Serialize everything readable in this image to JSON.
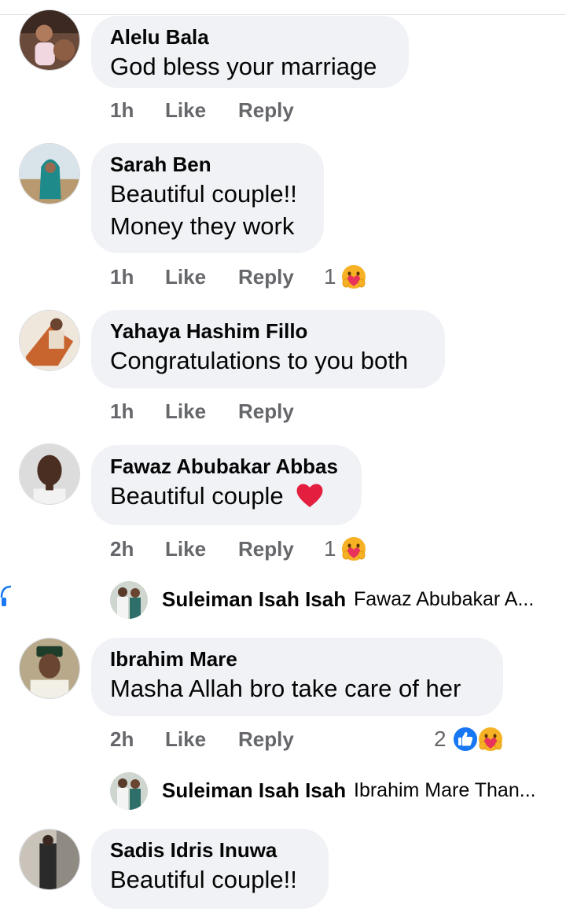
{
  "actions": {
    "like": "Like",
    "reply": "Reply"
  },
  "comments": [
    {
      "name": "Alelu Bala",
      "lines": [
        "God bless your marriage"
      ],
      "time": "1h",
      "reaction_count": ""
    },
    {
      "name": "Sarah Ben",
      "lines": [
        "Beautiful couple!!",
        "Money they work"
      ],
      "time": "1h",
      "reaction_count": "1"
    },
    {
      "name": "Yahaya Hashim Fillo",
      "lines": [
        "Congratulations to you both"
      ],
      "time": "1h",
      "reaction_count": ""
    },
    {
      "name": "Fawaz Abubakar Abbas",
      "lines": [
        "Beautiful couple"
      ],
      "time": "2h",
      "reaction_count": "1"
    },
    {
      "name": "Ibrahim Mare",
      "lines": [
        "Masha Allah bro take care of her"
      ],
      "time": "2h",
      "reaction_count": "2"
    },
    {
      "name": "Sadis Idris Inuwa",
      "lines": [
        "Beautiful couple!!"
      ],
      "time": "",
      "reaction_count": ""
    }
  ],
  "replies": [
    {
      "name": "Suleiman Isah Isah",
      "preview": "Fawaz Abubakar A..."
    },
    {
      "name": "Suleiman Isah Isah",
      "preview": "Ibrahim Mare Than..."
    }
  ],
  "icons": {
    "heart": "red-heart-emoji",
    "care": "care-reaction-emoji",
    "like": "like-reaction-icon"
  },
  "colors": {
    "bubble": "#f0f2f5",
    "meta_text": "#65676b",
    "like_blue": "#1877f2",
    "heart_red": "#e41e3f"
  }
}
